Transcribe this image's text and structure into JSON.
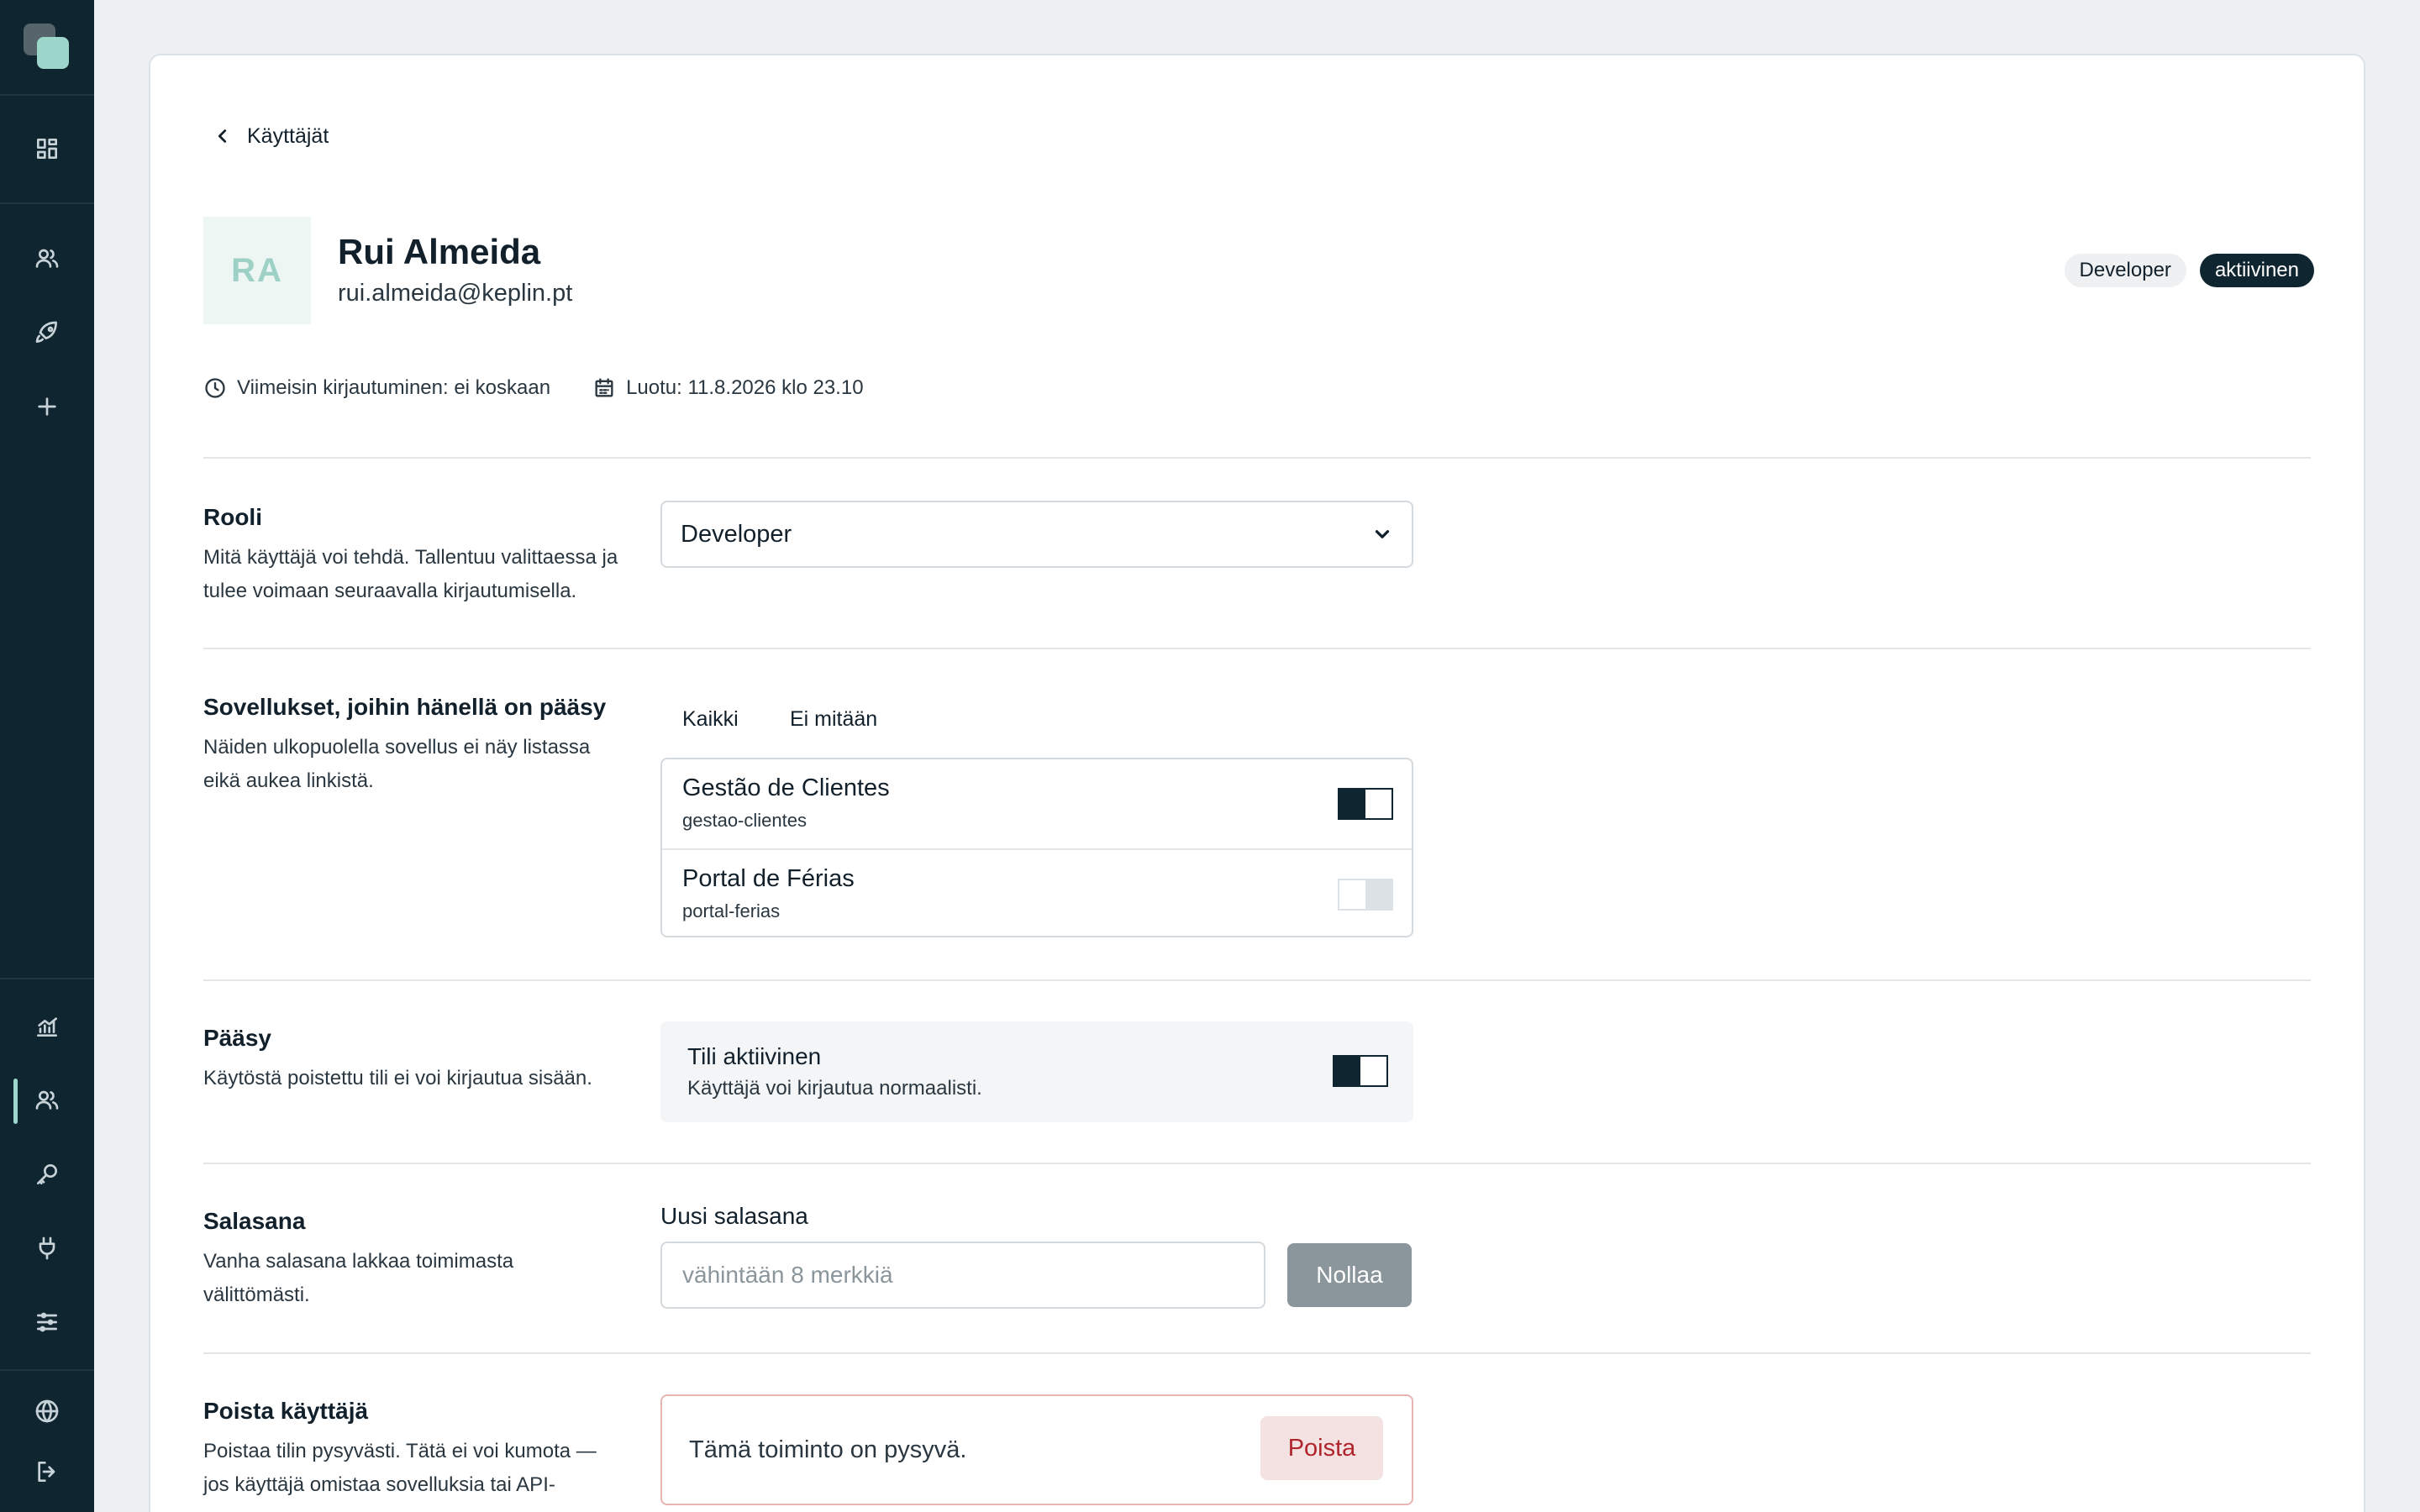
{
  "nav": {
    "icons": [
      "dashboard-icon",
      "users-icon",
      "rocket-icon",
      "plus-icon",
      "analytics-icon",
      "users-active-icon",
      "key-icon",
      "plug-icon",
      "sliders-icon",
      "globe-icon",
      "logout-icon"
    ]
  },
  "back": {
    "label": "Käyttäjät"
  },
  "user": {
    "initials": "RA",
    "name": "Rui Almeida",
    "email": "rui.almeida@keplin.pt",
    "role_badge": "Developer",
    "status_badge": "aktiivinen",
    "last_login": "Viimeisin kirjautuminen: ei koskaan",
    "created": "Luotu: 11.8.2026 klo 23.10"
  },
  "role_section": {
    "title": "Rooli",
    "desc": "Mitä käyttäjä voi tehdä. Tallentuu valittaessa ja tulee voimaan seuraavalla kirjautumisella.",
    "selected": "Developer"
  },
  "apps_section": {
    "title": "Sovellukset, joihin hänellä on pääsy",
    "desc": "Näiden ulkopuolella sovellus ei näy listassa eikä aukea linkistä.",
    "all_label": "Kaikki",
    "none_label": "Ei mitään",
    "apps": [
      {
        "name": "Gestão de Clientes",
        "slug": "gestao-clientes",
        "enabled": true
      },
      {
        "name": "Portal de Férias",
        "slug": "portal-ferias",
        "enabled": false
      }
    ]
  },
  "access_section": {
    "title": "Pääsy",
    "desc": "Käytöstä poistettu tili ei voi kirjautua sisään.",
    "toggle_title": "Tili aktiivinen",
    "toggle_desc": "Käyttäjä voi kirjautua normaalisti.",
    "enabled": true
  },
  "password_section": {
    "title": "Salasana",
    "desc": "Vanha salasana lakkaa toimimasta välittömästi.",
    "field_label": "Uusi salasana",
    "placeholder": "vähintään 8 merkkiä",
    "button": "Nollaa"
  },
  "delete_section": {
    "title": "Poista käyttäjä",
    "desc": "Poistaa tilin pysyvästi. Tätä ei voi kumota — jos käyttäjä omistaa sovelluksia tai API-",
    "warning": "Tämä toiminto on pysyvä.",
    "button": "Poista"
  },
  "colors": {
    "sidebar": "#0f2530",
    "accent": "#9dd7cc",
    "danger": "#b0242b"
  }
}
